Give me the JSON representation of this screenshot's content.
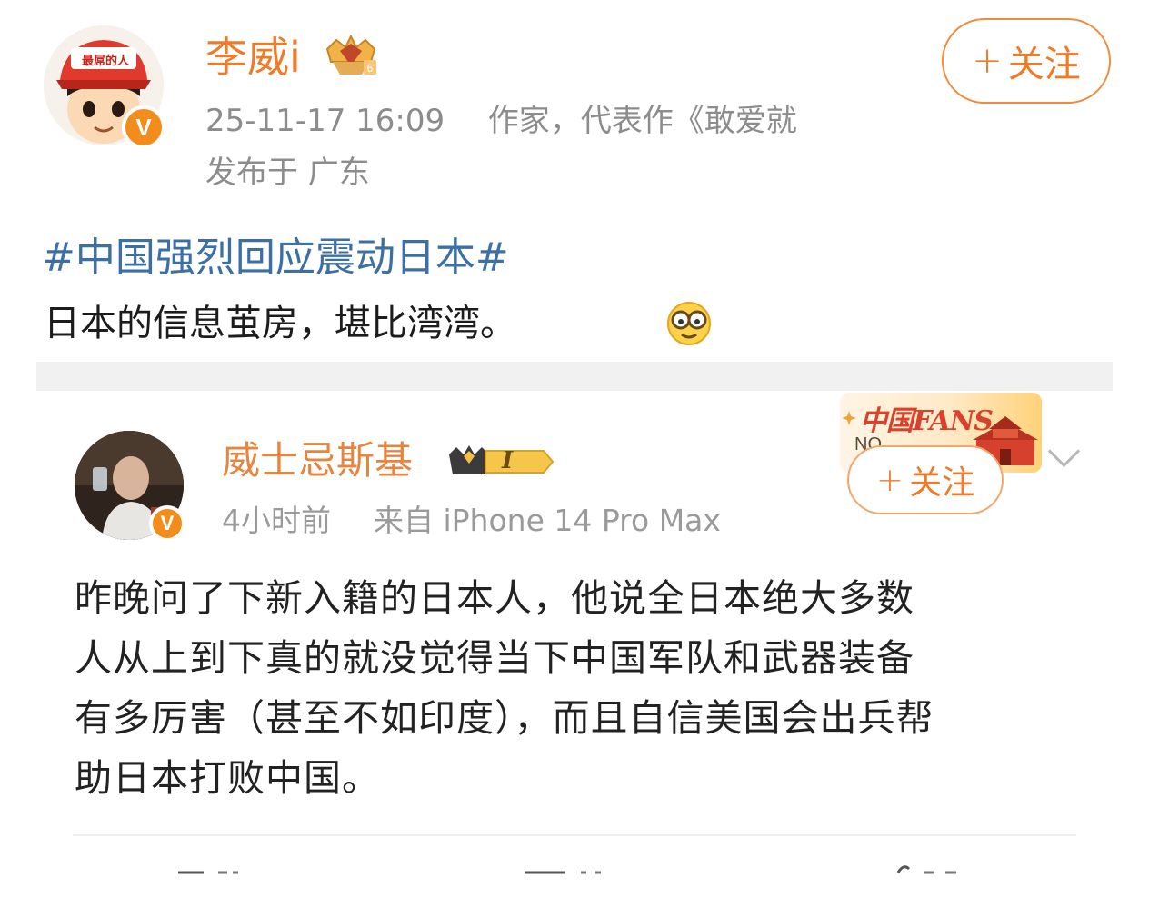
{
  "post": {
    "author": "李威i",
    "timestamp": "25-11-17 16:09",
    "bio": "作家，代表作《敢爱就",
    "location": "发布于 广东",
    "follow_label": "关注",
    "follow_plus": "+",
    "avatar_cap_text": "最屌的人",
    "verify_mark": "V",
    "hashtag": "#中国强烈回应震动日本#",
    "text": "日本的信息茧房，堪比湾湾。"
  },
  "quoted": {
    "author": "威士忌斯基",
    "level_badge": "I",
    "time": "4小时前",
    "source": "来自 iPhone 14 Pro Max",
    "follow_label": "关注",
    "follow_plus": "+",
    "verify_mark": "V",
    "fans_badge_text": "中国FANS",
    "fans_badge_no": "NO.",
    "lines": [
      "昨晚问了下新入籍的日本人，他说全日本绝大多数",
      "人从上到下真的就没觉得当下中国军队和武器装备",
      "有多厉害（甚至不如印度），而且自信美国会出兵帮",
      "助日本打败中国。"
    ]
  },
  "colors": {
    "accent_orange": "#f07a28",
    "hashtag_blue": "#3b6fa6",
    "meta_gray": "#8c8c8c"
  }
}
